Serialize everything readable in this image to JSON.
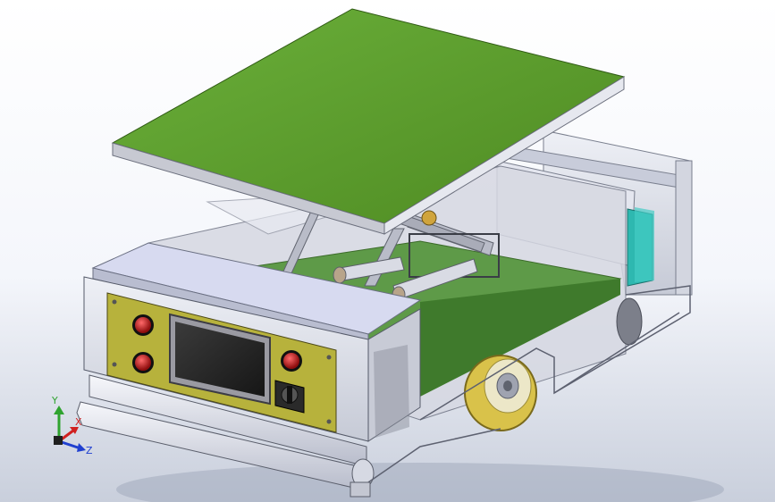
{
  "viewport": {
    "background_top": "#ffffff",
    "background_bottom": "#c9cfdc"
  },
  "model": {
    "platform_color": "#5a9a2a",
    "inner_plate_color": "#5e9a48",
    "control_panel_color": "#b7b23c",
    "button_color": "#c81e1e",
    "screen_color": "#2a2a2a",
    "wheel_color": "#d9c24a",
    "battery_color": "#2eb8b0",
    "frame_color": "#d9dce6"
  },
  "triad": {
    "y_label": "Y",
    "x_label": "X",
    "z_label": "Z",
    "y_color": "#2fa32f",
    "x_color": "#d02020",
    "z_color": "#2040d0"
  }
}
